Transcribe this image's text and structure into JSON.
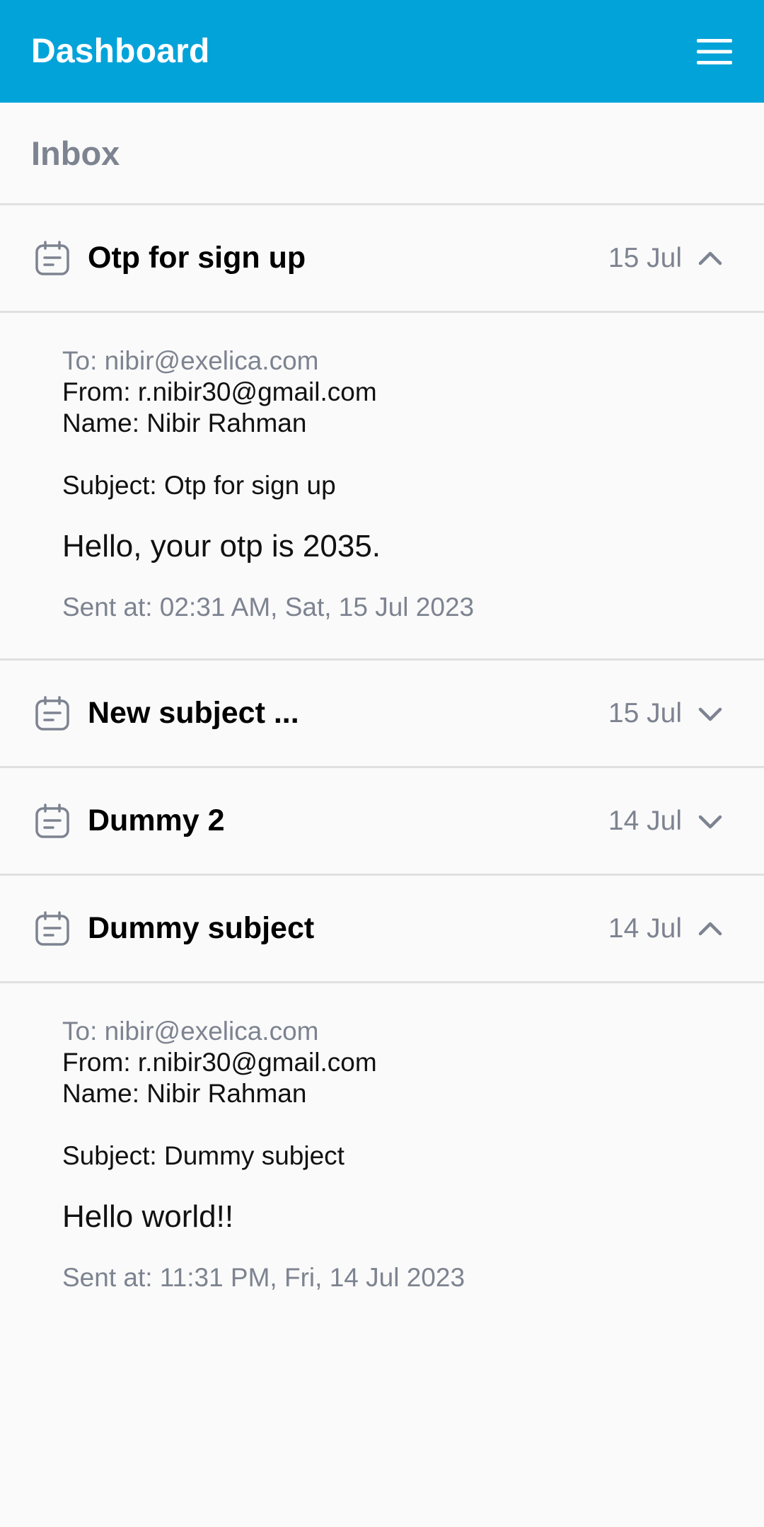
{
  "appbar": {
    "title": "Dashboard",
    "menu_icon": "hamburger-menu-icon",
    "background": "#02a3d9"
  },
  "inbox": {
    "title": "Inbox"
  },
  "mails": [
    {
      "subject": "Otp for sign up",
      "date": "15 Jul",
      "expanded": true,
      "to": "To: nibir@exelica.com",
      "from": "From: r.nibir30@gmail.com",
      "name": "Name: Nibir Rahman",
      "subject_line": "Subject: Otp for sign up",
      "message": "Hello, your otp is 2035.",
      "sent_at": "Sent at: 02:31 AM, Sat, 15 Jul 2023"
    },
    {
      "subject": "New subject ...",
      "date": "15 Jul",
      "expanded": false
    },
    {
      "subject": "Dummy 2",
      "date": "14 Jul",
      "expanded": false
    },
    {
      "subject": "Dummy subject",
      "date": "14 Jul",
      "expanded": true,
      "to": "To: nibir@exelica.com",
      "from": "From: r.nibir30@gmail.com",
      "name": "Name: Nibir Rahman",
      "subject_line": "Subject: Dummy subject",
      "message": "Hello world!!",
      "sent_at": "Sent at: 11:31 PM, Fri, 14 Jul 2023"
    }
  ],
  "icons": {
    "mail": "note-icon",
    "expanded": "chevron-up-icon",
    "collapsed": "chevron-down-icon"
  }
}
